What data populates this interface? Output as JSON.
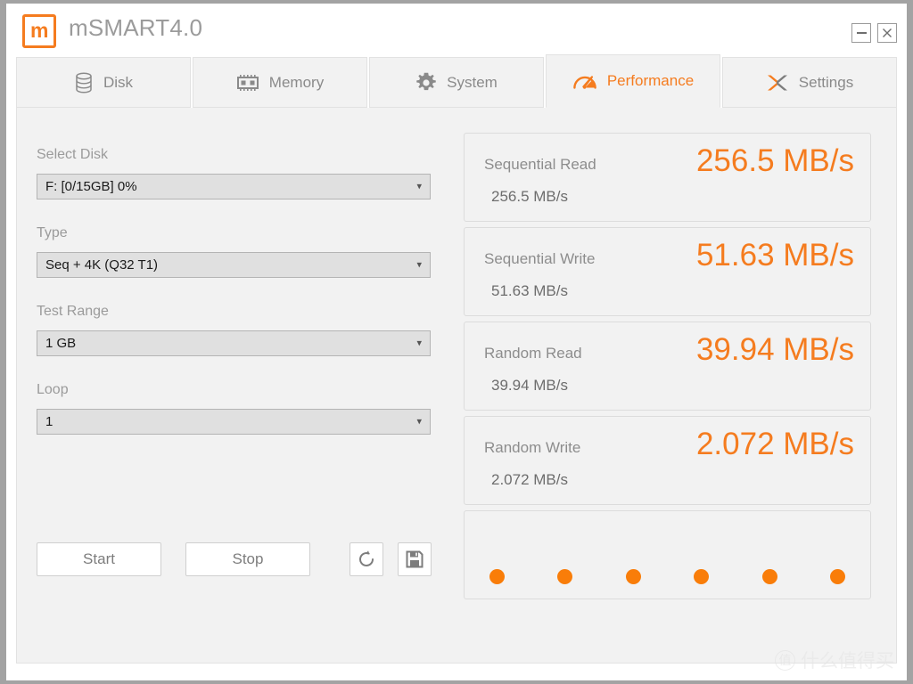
{
  "window": {
    "title": "mSMART4.0",
    "logo_letter": "m",
    "minimize_label": "–",
    "close_label": "✕"
  },
  "tabs": [
    {
      "label": "Disk",
      "icon": "database-icon",
      "active": false
    },
    {
      "label": "Memory",
      "icon": "memory-chip-icon",
      "active": false
    },
    {
      "label": "System",
      "icon": "gear-icon",
      "active": false
    },
    {
      "label": "Performance",
      "icon": "speedometer-icon",
      "active": true
    },
    {
      "label": "Settings",
      "icon": "cross-arrows-icon",
      "active": false
    }
  ],
  "form": {
    "fields": [
      {
        "label": "Select Disk",
        "value": "F: [0/15GB] 0%"
      },
      {
        "label": "Type",
        "value": "Seq + 4K (Q32 T1)"
      },
      {
        "label": "Test Range",
        "value": "1 GB"
      },
      {
        "label": "Loop",
        "value": "1"
      }
    ],
    "buttons": {
      "start": "Start",
      "stop": "Stop",
      "refresh_icon": "refresh-icon",
      "save_icon": "save-floppy-icon"
    }
  },
  "results": [
    {
      "title": "Sequential Read",
      "value": "256.5 MB/s",
      "sub": "256.5 MB/s"
    },
    {
      "title": "Sequential Write",
      "value": "51.63 MB/s",
      "sub": "51.63 MB/s"
    },
    {
      "title": "Random Read",
      "value": "39.94 MB/s",
      "sub": "39.94 MB/s"
    },
    {
      "title": "Random Write",
      "value": "2.072 MB/s",
      "sub": "2.072 MB/s"
    }
  ],
  "progress": {
    "dot_count": 6,
    "dot_color": "#f97d09"
  },
  "watermark": {
    "badge": "值",
    "text": "什么值得买"
  },
  "colors": {
    "accent": "#f57c1f",
    "panel": "#f2f2f2",
    "text_muted": "#9b9b9b"
  }
}
